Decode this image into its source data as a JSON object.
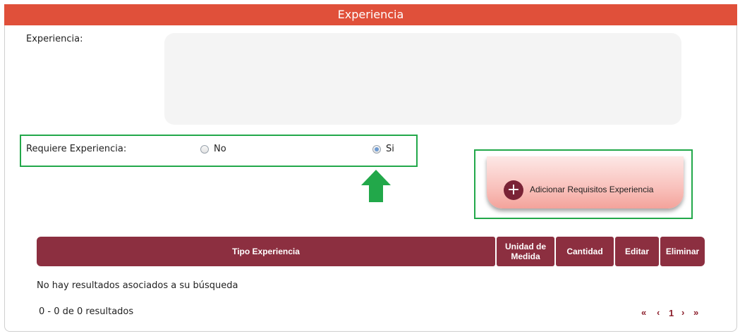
{
  "header": {
    "title": "Experiencia"
  },
  "experiencia": {
    "label": "Experiencia:",
    "value": ""
  },
  "requiere": {
    "label": "Requiere Experiencia:",
    "options": [
      {
        "label": "No",
        "checked": false
      },
      {
        "label": "Si",
        "checked": true
      }
    ]
  },
  "add_button": {
    "label": "Adicionar Requisitos Experiencia",
    "icon": "plus-circle-icon"
  },
  "table": {
    "columns": [
      "Tipo Experiencia",
      "Unidad de Medida",
      "Cantidad",
      "Editar",
      "Eliminar"
    ],
    "empty_message": "No hay resultados asociados a su búsqueda"
  },
  "pagination": {
    "summary": "0 - 0 de 0 resultados",
    "first": "«",
    "prev": "‹",
    "current_page": "1",
    "next": "›",
    "last": "»"
  },
  "colors": {
    "header": "#e0503a",
    "table_header": "#8c2f40",
    "highlight_box": "#22a84a",
    "arrow": "#22a84a",
    "pager": "#8c1f2c"
  }
}
